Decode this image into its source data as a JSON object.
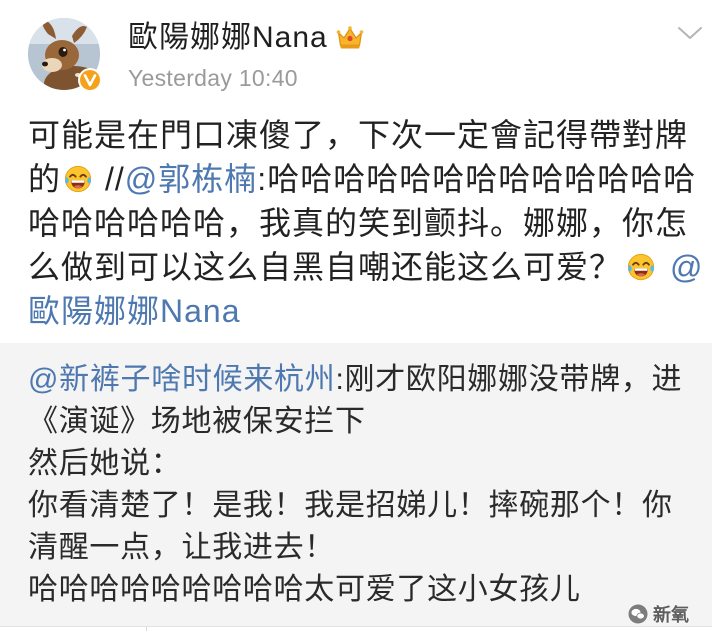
{
  "author": {
    "name": "歐陽娜娜Nana",
    "verified": true,
    "member": true
  },
  "post": {
    "timestamp": "Yesterday 10:40",
    "line1": "可能是在門口凍傻了，下次一定會記得帶對牌",
    "line2_text": "的",
    "line2_sep": "//",
    "line2_mention": "@郭栋楠",
    "line2_rest": ":哈哈哈哈哈哈哈哈哈哈哈哈哈",
    "line3": "哈哈哈哈哈哈，我真的笑到颤抖。娜娜，你怎",
    "line4_text": "么做到可以这么自黑自嘲还能这么可爱？",
    "line4_mention": "@",
    "line5_mention": "歐陽娜娜Nana"
  },
  "retweet": {
    "line1_mention": "@新裤子啥时候来杭州",
    "line1_rest": ":刚才欧阳娜娜没带牌，进",
    "line2": "《演诞》场地被保安拦下",
    "line3": "然后她说：",
    "line4": "你看清楚了！是我！我是招娣儿！摔碗那个！你",
    "line5": "清醒一点，让我进去！",
    "line6": "哈哈哈哈哈哈哈哈哈太可爱了这小女孩儿"
  },
  "watermark": {
    "text": "新氧"
  },
  "icons": {
    "avatar": "deer-avatar-image",
    "verified_badge": "verified-v-icon",
    "member_badge": "crown-icon",
    "menu": "chevron-down-icon",
    "emoji": "laugh-cry-emoji-icon",
    "watermark": "wechat-icon"
  },
  "colors": {
    "text": "#222222",
    "link": "#4e78b0",
    "timestamp": "#9a9a9a",
    "retweet_background": "#f4f4f4",
    "verified": "#f5a21a",
    "crown": "#f7b52a"
  }
}
